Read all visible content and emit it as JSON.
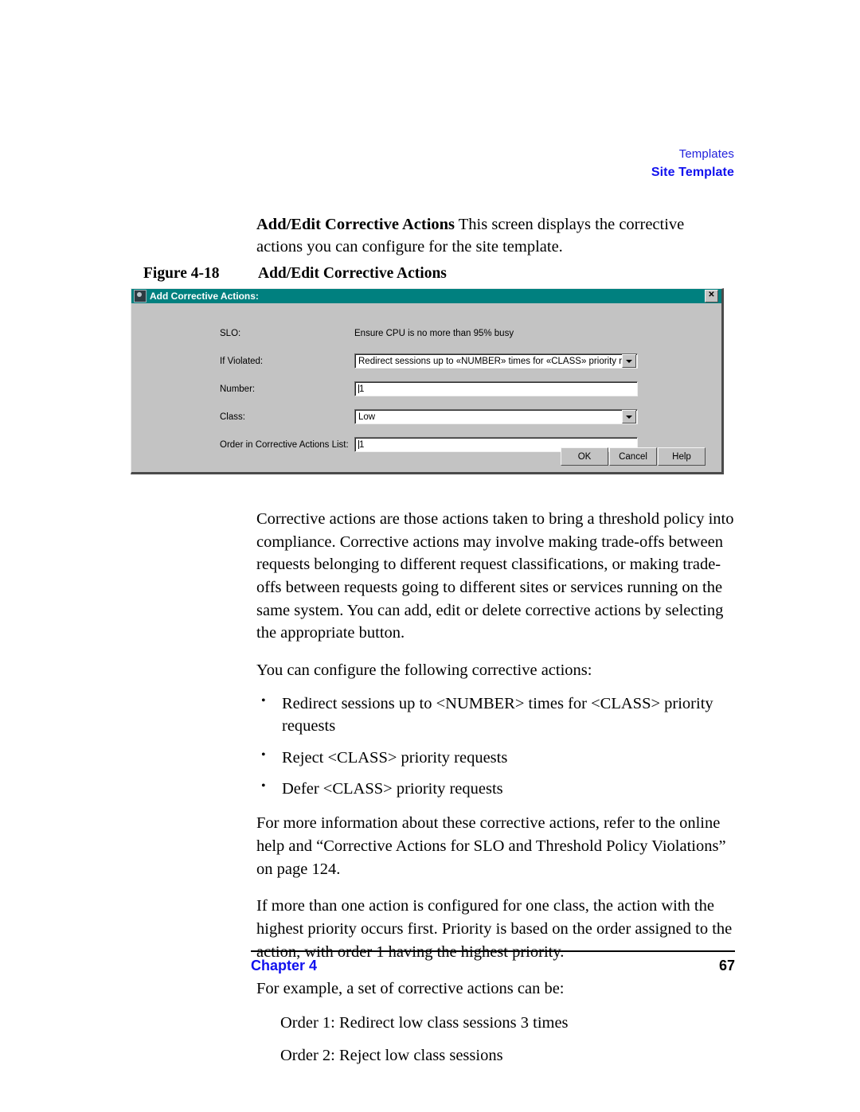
{
  "running_head": {
    "line1": "Templates",
    "line2": "Site Template",
    "color_line1": "#2222dd",
    "color_line2": "#1111ee"
  },
  "intro": {
    "lead": "Add/Edit Corrective Actions",
    "rest": "  This screen displays the corrective actions you can configure for the site template."
  },
  "figure": {
    "number": "Figure 4-18",
    "title": "Add/Edit Corrective Actions"
  },
  "dialog": {
    "title": "Add Corrective Actions:",
    "title_icon": "app-icon",
    "close_label": "✕",
    "titlebar_color": "#00807f",
    "face_color": "#c3c3c3",
    "fields": {
      "slo_label": "SLO:",
      "slo_value": "Ensure CPU is no more than 95% busy",
      "if_violated_label": "If Violated:",
      "if_violated_value": "Redirect sessions up to «NUMBER» times for «CLASS» priority request",
      "number_label": "Number:",
      "number_value": "1",
      "class_label": "Class:",
      "class_value": "Low",
      "order_label": "Order in Corrective Actions List:",
      "order_value": "1"
    },
    "buttons": {
      "ok": "OK",
      "cancel": "Cancel",
      "help": "Help"
    }
  },
  "body": {
    "para1": "Corrective actions are those actions taken to bring a threshold policy into compliance. Corrective actions may involve making trade-offs between requests belonging to different request classifications, or making trade-offs between requests going to different sites or services running on the same system. You can add, edit or delete corrective actions by selecting the appropriate button.",
    "para2": "You can configure the following corrective actions:",
    "bullets": [
      "Redirect sessions up to <NUMBER> times for <CLASS> priority requests",
      "Reject <CLASS> priority requests",
      "Defer <CLASS> priority requests"
    ],
    "para3": "For more information about these corrective actions, refer to the online help and “Corrective Actions for SLO and Threshold Policy Violations” on page 124.",
    "para4": "If more than one action is configured for one class, the action with the highest priority occurs first. Priority is based on the order assigned to the action, with order 1 having the highest priority.",
    "para5": "For example, a set of corrective actions can be:",
    "order1": "Order 1: Redirect low class sessions 3 times",
    "order2": "Order 2: Reject low class sessions"
  },
  "footer": {
    "chapter": "Chapter 4",
    "page": "67"
  }
}
